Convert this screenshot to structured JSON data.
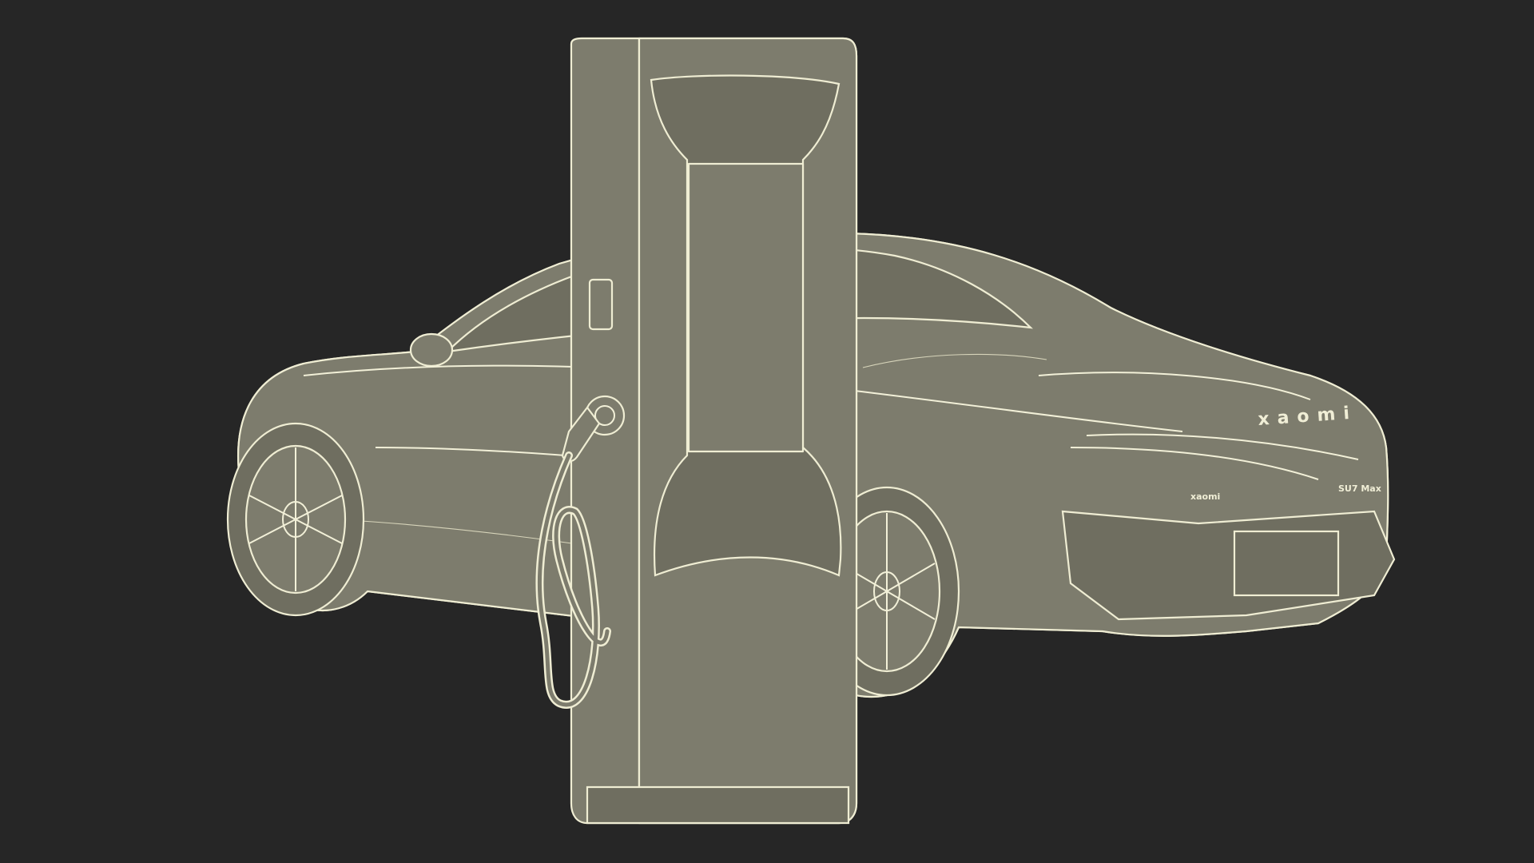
{
  "scene": {
    "background_color": "#262626",
    "wire_color": "#efedd3",
    "surface_color": "#7d7c6d"
  },
  "car": {
    "rear_badge": "xaomi",
    "trim_left": "xaomi",
    "trim_right": "SU7 Max"
  },
  "charger": {
    "panel": "display-panel",
    "connector": "charging-connector"
  }
}
